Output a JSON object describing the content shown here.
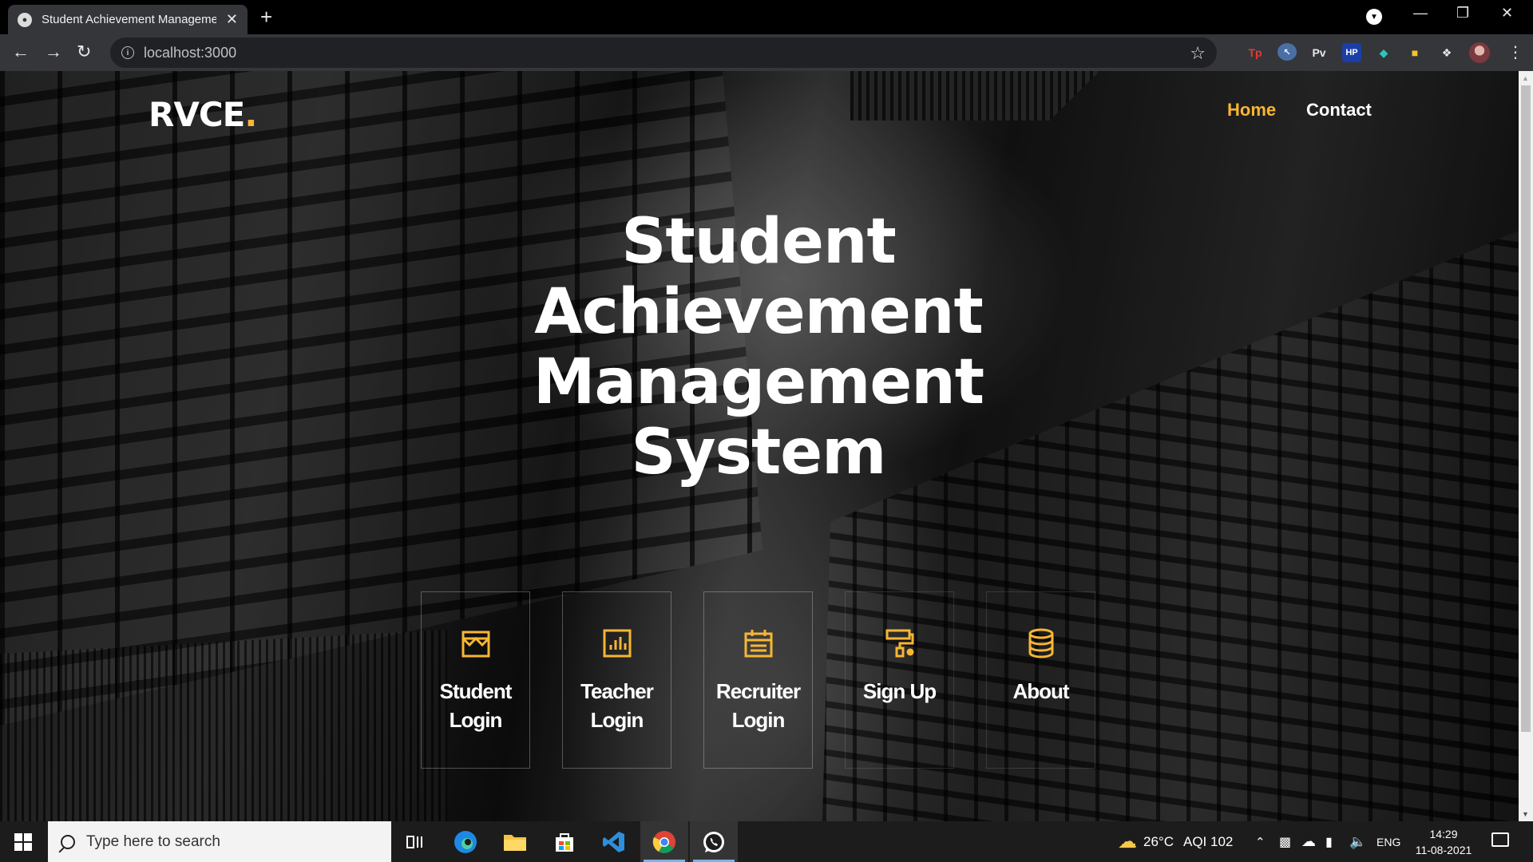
{
  "browser": {
    "tab_title": "Student Achievement Management System",
    "url": "localhost:3000",
    "extensions": [
      "Tp",
      "Pv",
      "HP"
    ]
  },
  "page": {
    "brand": "RVCE",
    "brand_dot": ".",
    "nav": {
      "home": "Home",
      "contact": "Contact"
    },
    "hero_lines": [
      "Student",
      "Achievement",
      "Management",
      "System"
    ],
    "cards": [
      {
        "label_line1": "Student",
        "label_line2": "Login",
        "icon": "store-icon"
      },
      {
        "label_line1": "Teacher",
        "label_line2": "Login",
        "icon": "bar-chart-icon"
      },
      {
        "label_line1": "Recruiter",
        "label_line2": "Login",
        "icon": "calendar-icon"
      },
      {
        "label_line1": "Sign Up",
        "label_line2": "",
        "icon": "paint-roller-icon"
      },
      {
        "label_line1": "About",
        "label_line2": "",
        "icon": "database-icon"
      }
    ],
    "accent_color": "#f7b634"
  },
  "taskbar": {
    "search_placeholder": "Type here to search",
    "weather_temp": "26°C",
    "aqi": "AQI 102",
    "language": "ENG",
    "time": "14:29",
    "date": "11-08-2021"
  }
}
